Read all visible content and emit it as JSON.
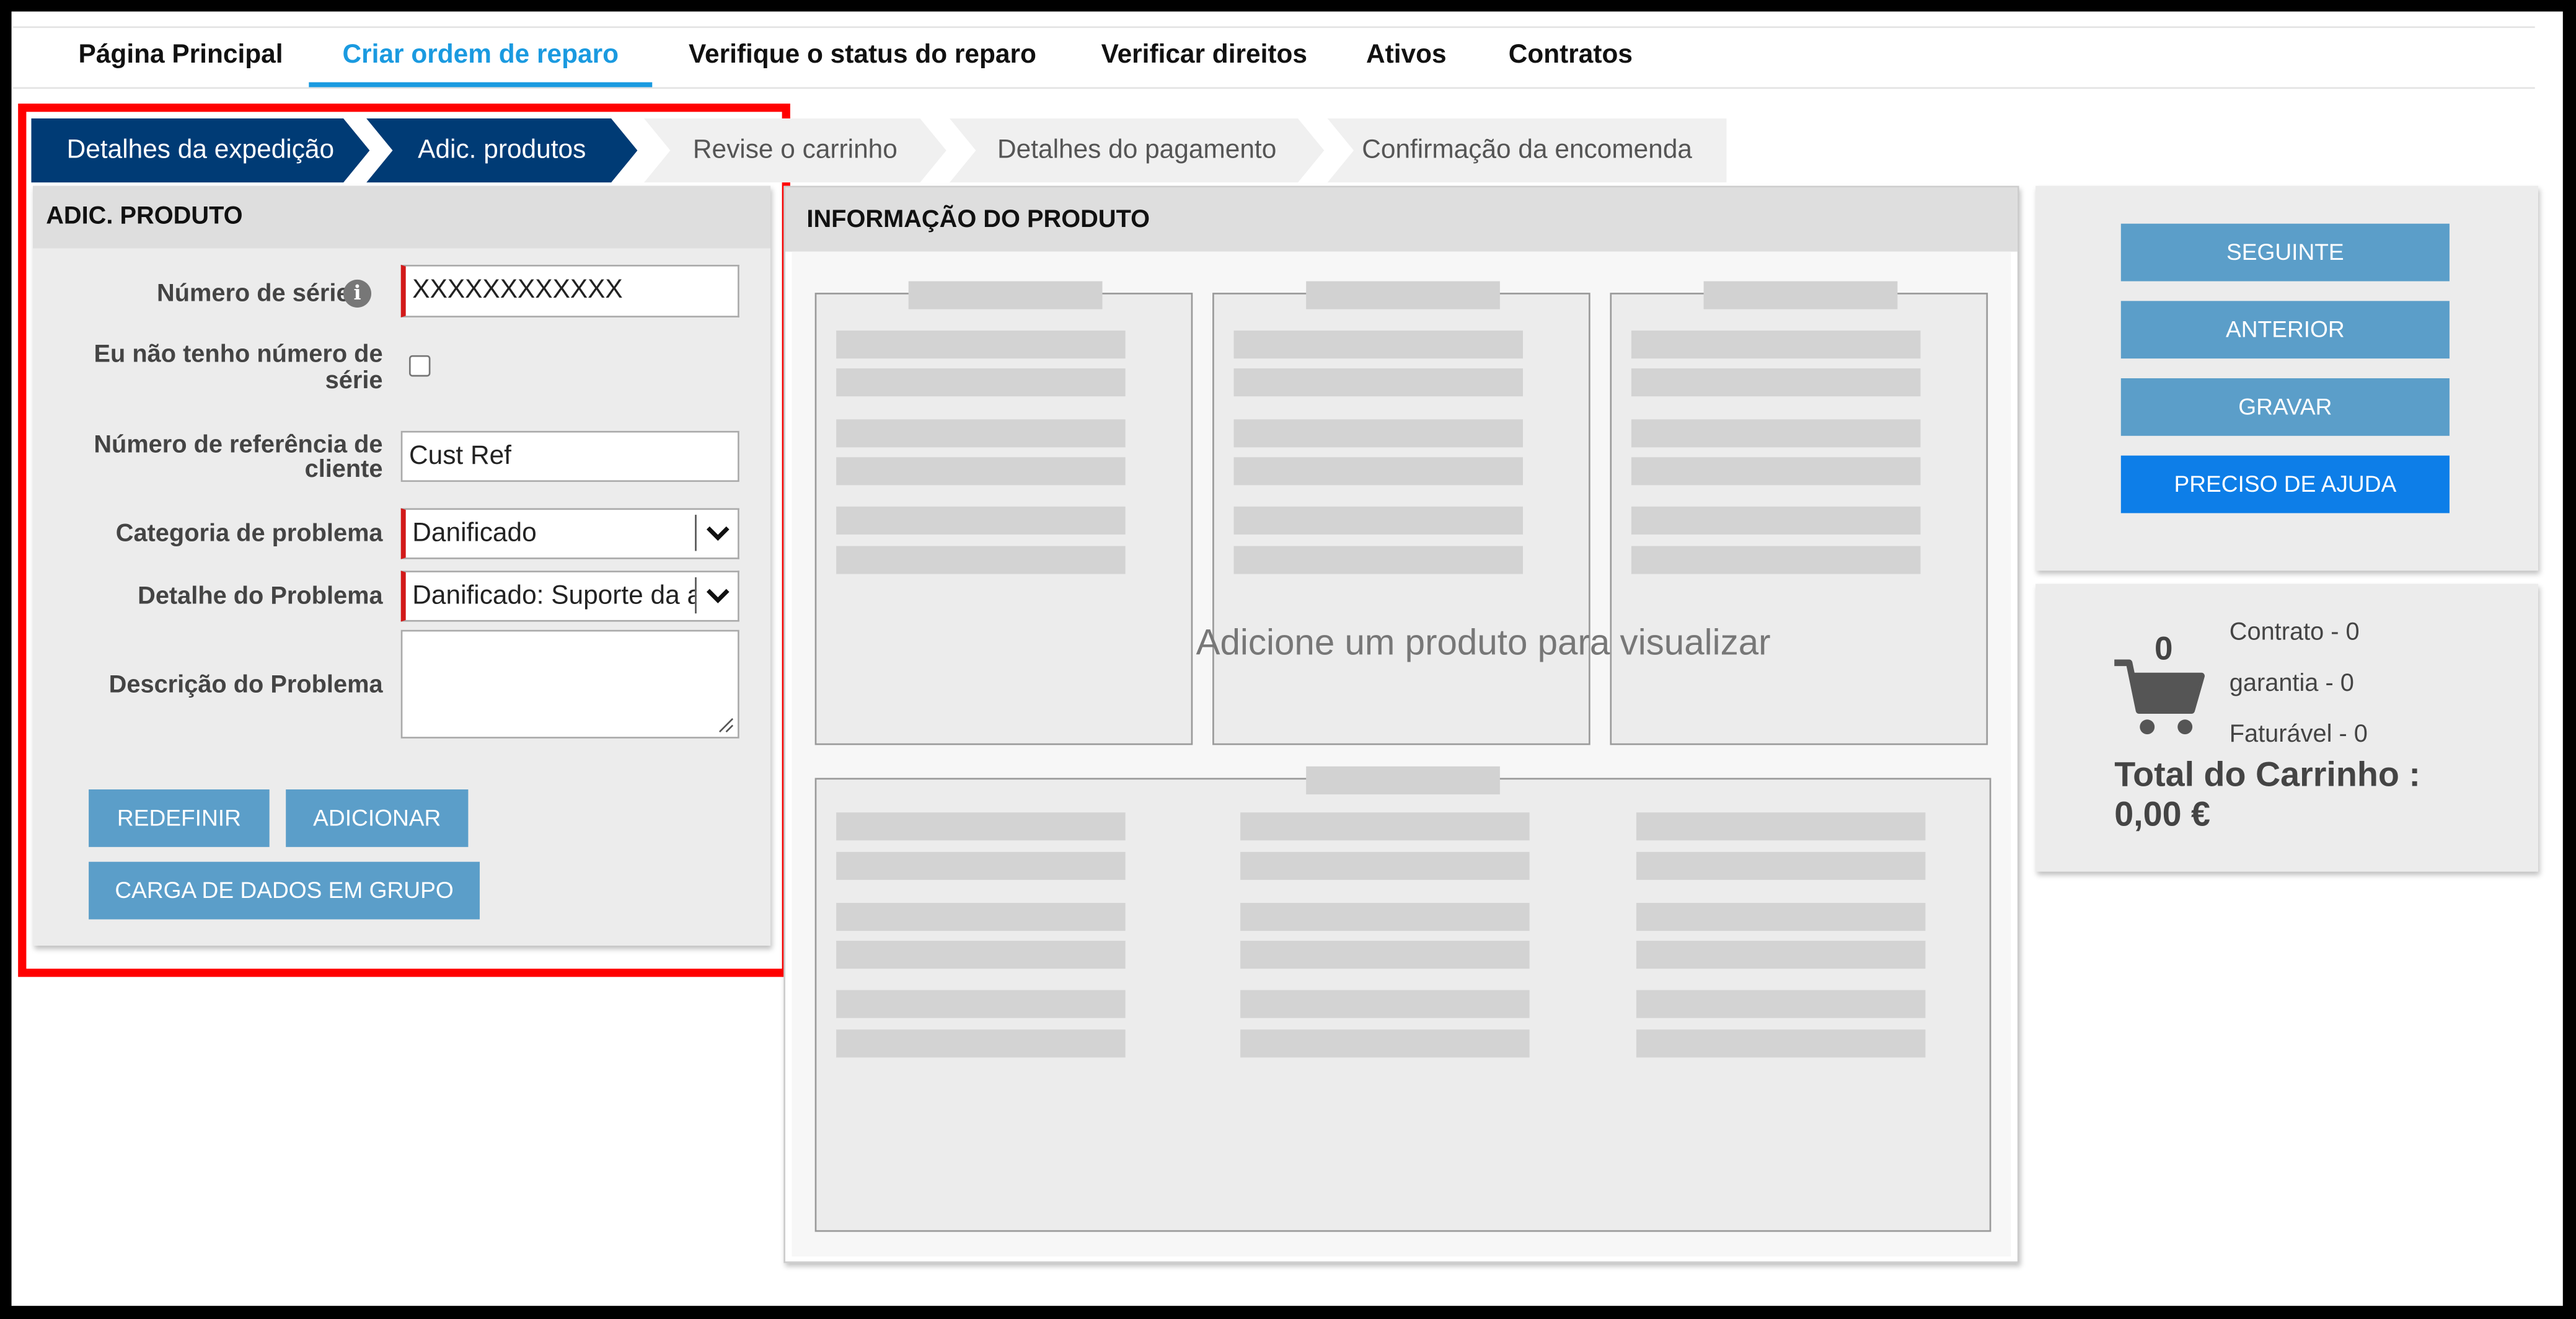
{
  "nav": {
    "items": [
      "Página Principal",
      "Criar ordem de reparo",
      "Verifique o status do reparo",
      "Verificar direitos",
      "Ativos",
      "Contratos"
    ],
    "active": "Criar ordem de reparo"
  },
  "wizard": {
    "steps": [
      "Detalhes da expedição",
      "Adic. produtos",
      "Revise o carrinho",
      "Detalhes do pagamento",
      "Confirmação da encomenda"
    ],
    "completed_count": 2
  },
  "add_product": {
    "title": "ADIC. PRODUTO",
    "serial_label": "Número de série",
    "serial_value": "XXXXXXXXXXXX",
    "no_serial_label_line1": "Eu não tenho número de",
    "no_serial_label_line2": "série",
    "no_serial_checked": false,
    "customer_ref_label_line1": "Número de referência de",
    "customer_ref_label_line2": "cliente",
    "customer_ref_value": "Cust Ref",
    "problem_category_label": "Categoria de problema",
    "problem_category_value": "Danificado",
    "problem_detail_label": "Detalhe do Problema",
    "problem_detail_value": "Danificado: Suporte da ar",
    "problem_description_label": "Descrição do Problema",
    "problem_description_value": "",
    "reset_button": "REDEFINIR",
    "add_button": "ADICIONAR",
    "bulk_upload_button": "CARGA DE DADOS EM GRUPO"
  },
  "product_info": {
    "title": "INFORMAÇÃO DO PRODUTO",
    "placeholder": "Adicione um produto para visualizar"
  },
  "actions": {
    "next": "SEGUINTE",
    "previous": "ANTERIOR",
    "save": "GRAVAR",
    "help": "PRECISO DE AJUDA"
  },
  "cart": {
    "count": "0",
    "contract": "Contrato - 0",
    "warranty": "garantia - 0",
    "billable": "Faturável - 0",
    "total_label": "Total do Carrinho :",
    "total_value": "0,00 €"
  },
  "colors": {
    "nav_active": "#1a9ae0",
    "wizard_done": "#003b75",
    "button": "#5b9ec9",
    "help_button": "#0d7ee8",
    "required_marker": "#d21a1a",
    "annotation": "#ff0000"
  },
  "icons": [
    "info-icon",
    "chevron-down-icon",
    "cart-icon",
    "resize-grip-icon"
  ]
}
